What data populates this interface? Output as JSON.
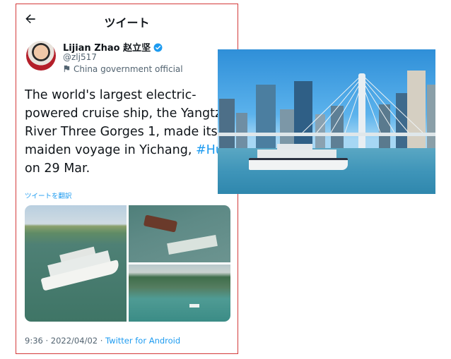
{
  "header": {
    "title": "ツイート",
    "back_icon": "arrow-left-icon"
  },
  "tweet": {
    "author_name": "Lijian Zhao 赵立坚",
    "handle": "@zlj517",
    "account_label": "China government official",
    "text_lines": [
      "The world's largest electric-",
      "powered cruise ship, the Yangtze",
      "River Three Gorges 1, made its",
      "maiden voyage in Yichang, "
    ],
    "hashtag": "#Hubei",
    "text_last_line": "on 29 Mar.",
    "translate_label": "ツイートを翻訳",
    "timestamp": "9:36 · 2022/04/02 · ",
    "source": "Twitter for Android"
  },
  "colors": {
    "accent": "#1d9bf0",
    "border": "#d33a3a",
    "text": "#0f1419",
    "muted": "#536471"
  }
}
